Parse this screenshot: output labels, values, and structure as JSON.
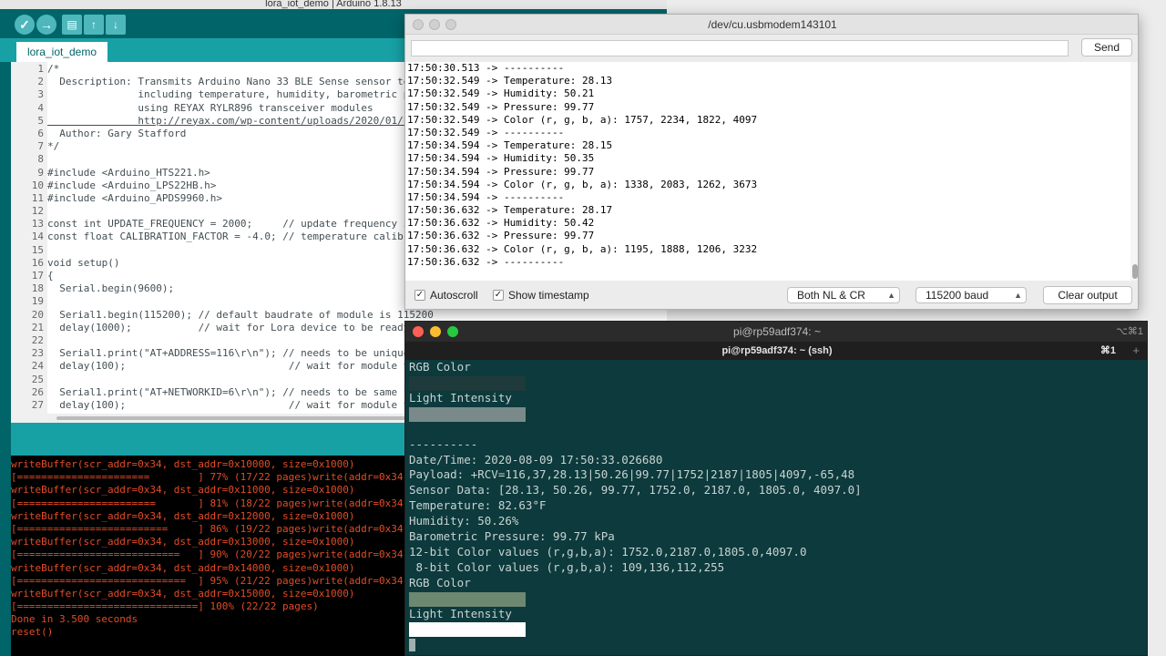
{
  "arduino": {
    "title": "lora_iot_demo | Arduino 1.8.13",
    "tab": "lora_iot_demo",
    "toolbar": {
      "verify_icon": "check-icon",
      "upload_icon": "arrow-right-icon",
      "new_icon": "new-file-icon",
      "open_icon": "arrow-up-icon",
      "save_icon": "arrow-down-icon"
    },
    "line_numbers": [
      "1",
      "2",
      "3",
      "4",
      "5",
      "6",
      "7",
      "8",
      "9",
      "10",
      "11",
      "12",
      "13",
      "14",
      "15",
      "16",
      "17",
      "18",
      "19",
      "20",
      "21",
      "22",
      "23",
      "24",
      "25",
      "26",
      "27"
    ],
    "code": [
      "/*",
      "  Description: Transmits Arduino Nano 33 BLE Sense sensor telem",
      "               including temperature, humidity, barometric pres",
      "               using REYAX RYLR896 transceiver modules",
      "               http://reyax.com/wp-content/uploads/2020/01/Lora",
      "  Author: Gary Stafford",
      "*/",
      "",
      "#include <Arduino_HTS221.h>",
      "#include <Arduino_LPS22HB.h>",
      "#include <Arduino_APDS9960.h>",
      "",
      "const int UPDATE_FREQUENCY = 2000;     // update frequency in m",
      "const float CALIBRATION_FACTOR = -4.0; // temperature calibrati",
      "",
      "void setup()",
      "{",
      "  Serial.begin(9600);",
      "",
      "  Serial1.begin(115200); // default baudrate of module is 115200",
      "  delay(1000);           // wait for Lora device to be ready",
      "",
      "  Serial1.print(\"AT+ADDRESS=116\\r\\n\"); // needs to be unique",
      "  delay(100);                           // wait for module to re",
      "",
      "  Serial1.print(\"AT+NETWORKID=6\\r\\n\"); // needs to be same for",
      "  delay(100);                           // wait for module to re"
    ],
    "console": [
      "writeBuffer(scr_addr=0x34, dst_addr=0x10000, size=0x1000)",
      "[======================        ] 77% (17/22 pages)write(addr=0x34,siz",
      "writeBuffer(scr_addr=0x34, dst_addr=0x11000, size=0x1000)",
      "[=======================       ] 81% (18/22 pages)write(addr=0x34,siz",
      "writeBuffer(scr_addr=0x34, dst_addr=0x12000, size=0x1000)",
      "[=========================     ] 86% (19/22 pages)write(addr=0x34,siz",
      "writeBuffer(scr_addr=0x34, dst_addr=0x13000, size=0x1000)",
      "[===========================   ] 90% (20/22 pages)write(addr=0x34,siz",
      "writeBuffer(scr_addr=0x34, dst_addr=0x14000, size=0x1000)",
      "[============================  ] 95% (21/22 pages)write(addr=0x34,siz",
      "writeBuffer(scr_addr=0x34, dst_addr=0x15000, size=0x1000)",
      "[==============================] 100% (22/22 pages)",
      "Done in 3.500 seconds",
      "reset()"
    ]
  },
  "serial": {
    "title": "/dev/cu.usbmodem143101",
    "input_value": "",
    "send_label": "Send",
    "output": [
      "17:50:30.513 -> ----------",
      "17:50:32.549 -> Temperature: 28.13",
      "17:50:32.549 -> Humidity: 50.21",
      "17:50:32.549 -> Pressure: 99.77",
      "17:50:32.549 -> Color (r, g, b, a): 1757, 2234, 1822, 4097",
      "17:50:32.549 -> ----------",
      "17:50:34.594 -> Temperature: 28.15",
      "17:50:34.594 -> Humidity: 50.35",
      "17:50:34.594 -> Pressure: 99.77",
      "17:50:34.594 -> Color (r, g, b, a): 1338, 2083, 1262, 3673",
      "17:50:34.594 -> ----------",
      "17:50:36.632 -> Temperature: 28.17",
      "17:50:36.632 -> Humidity: 50.42",
      "17:50:36.632 -> Pressure: 99.77",
      "17:50:36.632 -> Color (r, g, b, a): 1195, 1888, 1206, 3232",
      "17:50:36.632 -> ----------"
    ],
    "autoscroll_label": "Autoscroll",
    "autoscroll_checked": true,
    "timestamp_label": "Show timestamp",
    "timestamp_checked": true,
    "line_ending": "Both NL & CR",
    "baud": "115200 baud",
    "clear_label": "Clear output"
  },
  "terminal": {
    "title": "pi@rp59adf374: ~",
    "title_shortcut": "⌥⌘1",
    "tab": "pi@rp59adf374: ~ (ssh)",
    "tab_shortcut": "⌘1",
    "plus_icon": "plus-icon",
    "lines": {
      "rgb_label_1": "RGB Color",
      "light_label_1": "Light Intensity",
      "separator": "----------",
      "datetime": "Date/Time: 2020-08-09 17:50:33.026680",
      "payload": "Payload: +RCV=116,37,28.13|50.26|99.77|1752|2187|1805|4097,-65,48",
      "sensor": "Sensor Data: [28.13, 50.26, 99.77, 1752.0, 2187.0, 1805.0, 4097.0]",
      "temperature": "Temperature: 82.63°F",
      "humidity": "Humidity: 50.26%",
      "pressure": "Barometric Pressure: 99.77 kPa",
      "color12": "12-bit Color values (r,g,b,a): 1752.0,2187.0,1805.0,4097.0",
      "color8": " 8-bit Color values (r,g,b,a): 109,136,112,255",
      "rgb_label_2": "RGB Color",
      "light_label_2": "Light Intensity"
    },
    "colors": {
      "rgb_swatch_1": "#1f3a3b",
      "light_swatch_1": "#7a8a8a",
      "rgb_swatch_2": "#6d8870",
      "light_swatch_2": "#ffffff"
    }
  }
}
